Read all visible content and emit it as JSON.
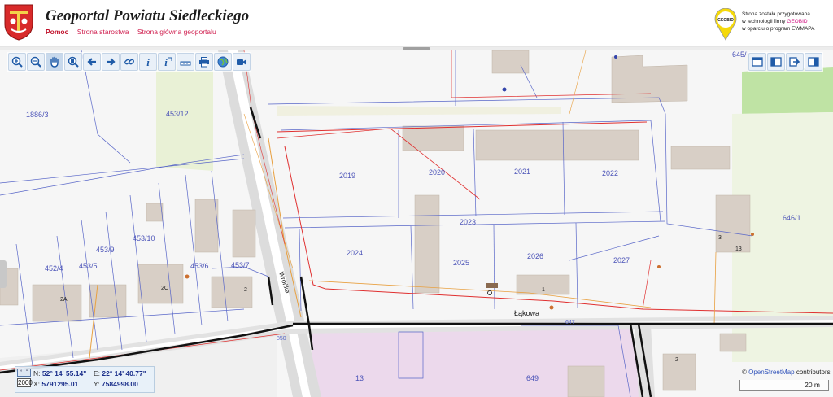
{
  "header": {
    "title": "Geoportal Powiatu Siedleckiego",
    "nav": [
      "Pomoc",
      "Strona starostwa",
      "Strona główna geoportalu"
    ],
    "geobid_logo_text": "GEOBID",
    "credit_line1": "Strona została przygotowana",
    "credit_line2_prefix": "w technologii firmy ",
    "credit_line2_brand": "GEOBID",
    "credit_line3": "w oparciu o program EWMAPA"
  },
  "toolbar_left": [
    {
      "name": "zoom-in-icon",
      "label": "+"
    },
    {
      "name": "zoom-out-icon",
      "label": "-"
    },
    {
      "name": "pan-hand-icon",
      "label": "hand"
    },
    {
      "name": "zoom-window-icon",
      "label": "zoom"
    },
    {
      "name": "arrow-back-icon",
      "label": "back"
    },
    {
      "name": "arrow-forward-icon",
      "label": "forward"
    },
    {
      "name": "link-icon",
      "label": "link"
    },
    {
      "name": "info-icon",
      "label": "i"
    },
    {
      "name": "info-edit-icon",
      "label": "i"
    },
    {
      "name": "measure-ruler-icon",
      "label": "ruler"
    },
    {
      "name": "print-icon",
      "label": "print"
    },
    {
      "name": "globe-icon",
      "label": "globe"
    },
    {
      "name": "video-camera-icon",
      "label": "camera"
    }
  ],
  "toolbar_right": [
    {
      "name": "window-layout-icon"
    },
    {
      "name": "panel-left-icon"
    },
    {
      "name": "export-arrow-icon"
    },
    {
      "name": "panel-right-icon"
    }
  ],
  "map": {
    "parcels": [
      "1886/3",
      "453/12",
      "2019",
      "2020",
      "2021",
      "2022",
      "2023",
      "646/1",
      "452/4",
      "453/5",
      "453/9",
      "453/10",
      "453/6",
      "453/7",
      "2024",
      "2025",
      "2026",
      "2027",
      "13",
      "649",
      "645/"
    ],
    "building_numbers": [
      "2A",
      "2C",
      "2",
      "1",
      "3",
      "13",
      "2"
    ],
    "streets": [
      "Łąkowa",
      "Wrońka"
    ],
    "small_labels": [
      "647",
      "850"
    ]
  },
  "coords": {
    "n_label": "N:",
    "n_value": "52° 14' 55.14\"",
    "e_label": "E:",
    "e_value": "22° 14' 40.77\"",
    "x_label": "X:",
    "x_value": "5791295.01",
    "y_label": "Y:",
    "y_value": "7584998.00",
    "epsg": "2000"
  },
  "attribution": {
    "prefix": "© ",
    "osm": "OpenStreetMap",
    "suffix": " contributors"
  },
  "scale_label": "20 m"
}
